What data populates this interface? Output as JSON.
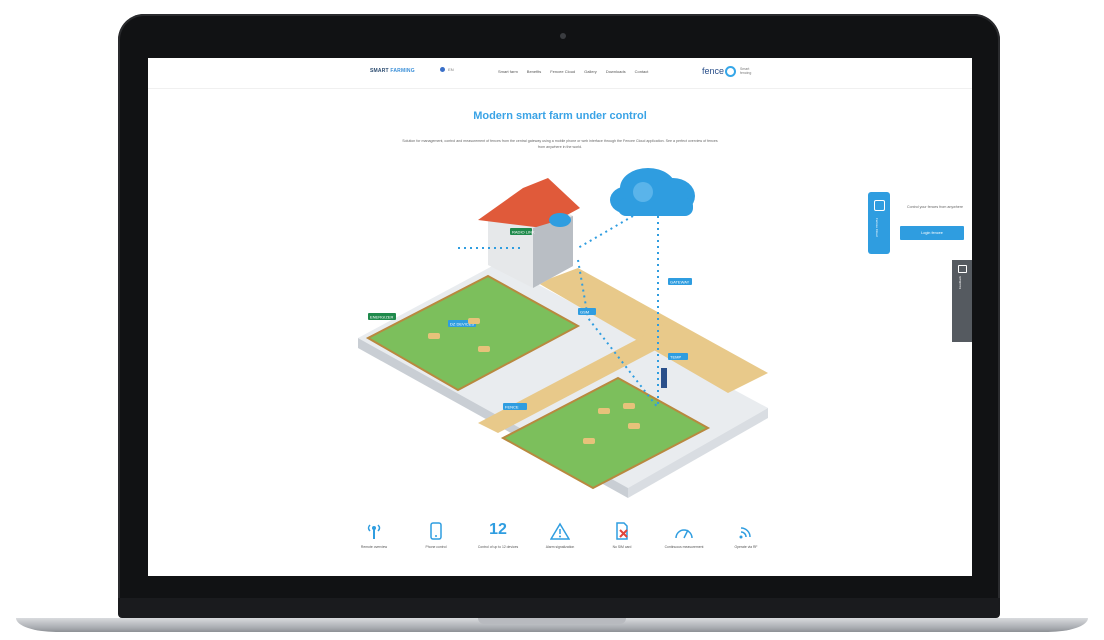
{
  "page": {
    "nav": {
      "logo_main": "SMART",
      "logo_sub": "FARMING",
      "language": "EN",
      "items": [
        "Smart farm",
        "Benefits",
        "Fencee Cloud",
        "Gallery",
        "Downloads",
        "Contact"
      ],
      "brand": "fence",
      "brand_sub": "Smart fencing"
    },
    "hero": {
      "title": "Modern smart farm under control",
      "text": "Solution for management, control and measurement of fences from the central gateway using a mobile phone or web interface through the Fencee Cloud application. See a perfect overview of fences from anywhere in the world."
    },
    "side_panel": {
      "tab_label": "Fencee Cloud",
      "text": "Control your fences from anywhere",
      "button": "Login fencee"
    },
    "feedback_label": "Feedback",
    "farm": {
      "labels": [
        "RADIO LINK",
        "GATEWAY",
        "GSM",
        "ENERGIZER",
        "DZ DEVICES",
        "TEMP",
        "FENCE"
      ]
    },
    "features": [
      {
        "icon": "antenna-icon",
        "label": "Remote overview"
      },
      {
        "icon": "phone-icon",
        "label": "Phone control"
      },
      {
        "icon": "number",
        "value": "12",
        "label": "Control of up to 12 devices"
      },
      {
        "icon": "warning-icon",
        "label": "Alarm signalization"
      },
      {
        "icon": "no-sim-icon",
        "label": "No SIM card"
      },
      {
        "icon": "gauge-icon",
        "label": "Continuous measurement"
      },
      {
        "icon": "wifi-icon",
        "label": "Operate via RF"
      }
    ],
    "colors": {
      "accent": "#2f9de0",
      "grass": "#77b85a",
      "roof": "#e05a3a",
      "cloud": "#2f9de0"
    }
  }
}
